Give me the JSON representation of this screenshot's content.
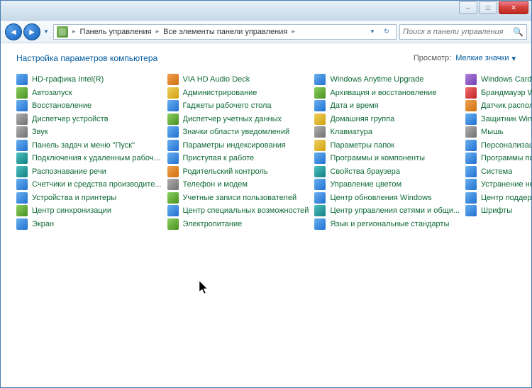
{
  "window": {
    "minimize": "–",
    "maximize": "□",
    "close": "✕"
  },
  "nav": {
    "back": "◄",
    "forward": "►",
    "history": "▼",
    "crumbs": [
      "Панель управления",
      "Все элементы панели управления"
    ],
    "sep": "▸",
    "refresh": "↻",
    "dropdown": "▾"
  },
  "search": {
    "placeholder": "Поиск в панели управления",
    "icon": "🔍"
  },
  "header": {
    "title": "Настройка параметров компьютера",
    "view_label": "Просмотр:",
    "view_value": "Мелкие значки",
    "view_arrow": "▾"
  },
  "columns": [
    [
      {
        "label": "HD-графика Intel(R)",
        "ic": "ic-blue"
      },
      {
        "label": "Автозапуск",
        "ic": "ic-green"
      },
      {
        "label": "Восстановление",
        "ic": "ic-blue"
      },
      {
        "label": "Диспетчер устройств",
        "ic": "ic-gray"
      },
      {
        "label": "Звук",
        "ic": "ic-gray"
      },
      {
        "label": "Панель задач и меню \"Пуск\"",
        "ic": "ic-blue"
      },
      {
        "label": "Подключения к удаленным рабоч...",
        "ic": "ic-teal"
      },
      {
        "label": "Распознавание речи",
        "ic": "ic-teal"
      },
      {
        "label": "Счетчики и средства производите...",
        "ic": "ic-blue"
      },
      {
        "label": "Устройства и принтеры",
        "ic": "ic-blue"
      },
      {
        "label": "Центр синхронизации",
        "ic": "ic-green"
      },
      {
        "label": "Экран",
        "ic": "ic-blue"
      }
    ],
    [
      {
        "label": "VIA HD Audio Deck",
        "ic": "ic-orange"
      },
      {
        "label": "Администрирование",
        "ic": "ic-yellow"
      },
      {
        "label": "Гаджеты рабочего стола",
        "ic": "ic-blue"
      },
      {
        "label": "Диспетчер учетных данных",
        "ic": "ic-green"
      },
      {
        "label": "Значки области уведомлений",
        "ic": "ic-blue"
      },
      {
        "label": "Параметры индексирования",
        "ic": "ic-blue"
      },
      {
        "label": "Приступая к работе",
        "ic": "ic-blue"
      },
      {
        "label": "Родительский контроль",
        "ic": "ic-orange"
      },
      {
        "label": "Телефон и модем",
        "ic": "ic-gray"
      },
      {
        "label": "Учетные записи пользователей",
        "ic": "ic-green"
      },
      {
        "label": "Центр специальных возможностей",
        "ic": "ic-blue"
      },
      {
        "label": "Электропитание",
        "ic": "ic-green"
      }
    ],
    [
      {
        "label": "Windows Anytime Upgrade",
        "ic": "ic-blue"
      },
      {
        "label": "Архивация и восстановление",
        "ic": "ic-green"
      },
      {
        "label": "Дата и время",
        "ic": "ic-blue"
      },
      {
        "label": "Домашняя группа",
        "ic": "ic-yellow"
      },
      {
        "label": "Клавиатура",
        "ic": "ic-gray"
      },
      {
        "label": "Параметры папок",
        "ic": "ic-yellow"
      },
      {
        "label": "Программы и компоненты",
        "ic": "ic-blue"
      },
      {
        "label": "Свойства браузера",
        "ic": "ic-teal"
      },
      {
        "label": "Управление цветом",
        "ic": "ic-blue"
      },
      {
        "label": "Центр обновления Windows",
        "ic": "ic-blue"
      },
      {
        "label": "Центр управления сетями и общи...",
        "ic": "ic-teal"
      },
      {
        "label": "Язык и региональные стандарты",
        "ic": "ic-blue"
      }
    ],
    [
      {
        "label": "Windows CardSpace",
        "ic": "ic-purple"
      },
      {
        "label": "Брандмауэр Windows",
        "ic": "ic-red"
      },
      {
        "label": "Датчик расположения и другие дат...",
        "ic": "ic-orange"
      },
      {
        "label": "Защитник Windows",
        "ic": "ic-blue"
      },
      {
        "label": "Мышь",
        "ic": "ic-gray"
      },
      {
        "label": "Персонализация",
        "ic": "ic-blue"
      },
      {
        "label": "Программы по умолчанию",
        "ic": "ic-blue"
      },
      {
        "label": "Система",
        "ic": "ic-blue"
      },
      {
        "label": "Устранение неполадок",
        "ic": "ic-blue"
      },
      {
        "label": "Центр поддержки",
        "ic": "ic-blue"
      },
      {
        "label": "Шрифты",
        "ic": "ic-blue"
      }
    ]
  ]
}
